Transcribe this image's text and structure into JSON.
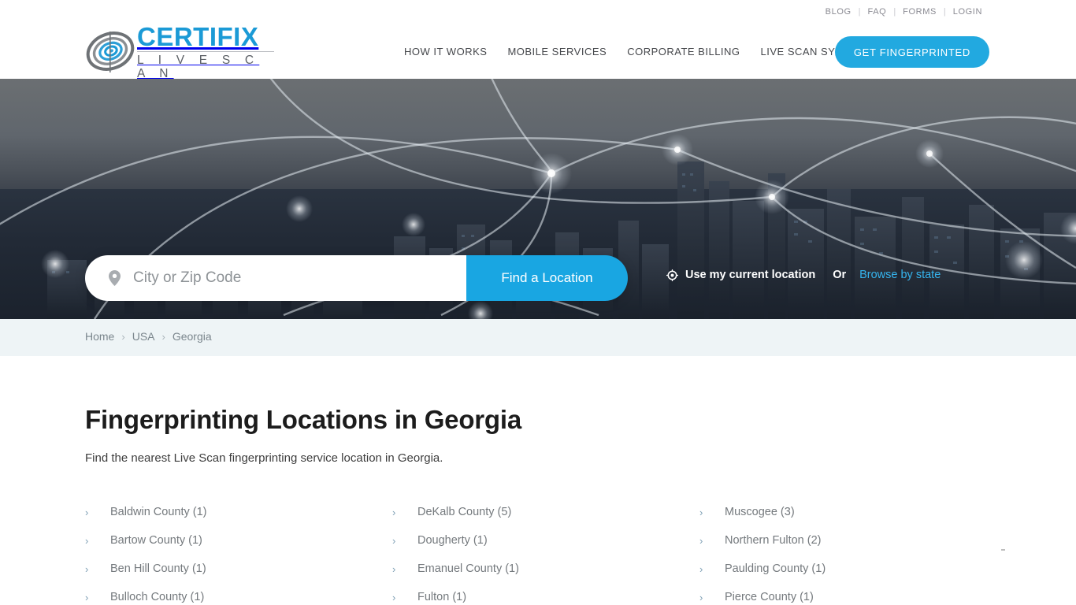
{
  "utility_nav": {
    "items": [
      {
        "label": "BLOG"
      },
      {
        "label": "FAQ"
      },
      {
        "label": "FORMS"
      },
      {
        "label": "LOGIN"
      }
    ],
    "separator": "|"
  },
  "brand": {
    "name_top": "CERTIFIX",
    "name_bottom": "L I V E S C A N",
    "logo_icon": "spiral-fingerprint-icon",
    "color_primary": "#1b9ad6",
    "color_secondary": "#5c6066"
  },
  "main_nav": {
    "items": [
      {
        "label": "HOW IT WORKS"
      },
      {
        "label": "MOBILE SERVICES"
      },
      {
        "label": "CORPORATE BILLING"
      },
      {
        "label": "LIVE SCAN SYSTEM"
      }
    ],
    "cta_label": "GET FINGERPRINTED",
    "cta_color": "#22a9e0"
  },
  "hero": {
    "background_description": "aerial city skyline with network node overlay",
    "search": {
      "pin_icon": "map-pin-icon",
      "placeholder": "City or Zip Code",
      "value": "",
      "button_label": "Find a Location",
      "button_color": "#19a6e2"
    },
    "locate_icon": "crosshair-icon",
    "locate_label": "Use my current location",
    "or_label": "Or",
    "browse_label": "Browse by state",
    "browse_color": "#35b4ee"
  },
  "breadcrumb": {
    "separator": "›",
    "items": [
      {
        "label": "Home"
      },
      {
        "label": "USA"
      },
      {
        "label": "Georgia"
      }
    ]
  },
  "main": {
    "title": "Fingerprinting Locations in Georgia",
    "subtitle": "Find the nearest Live Scan fingerprinting service location in Georgia.",
    "chevron": "›",
    "columns": [
      {
        "items": [
          {
            "label": "Baldwin County (1)"
          },
          {
            "label": "Bartow County (1)"
          },
          {
            "label": "Ben Hill County (1)"
          },
          {
            "label": "Bulloch County (1)"
          }
        ]
      },
      {
        "items": [
          {
            "label": "DeKalb County (5)"
          },
          {
            "label": "Dougherty (1)"
          },
          {
            "label": "Emanuel County (1)"
          },
          {
            "label": "Fulton (1)"
          }
        ]
      },
      {
        "items": [
          {
            "label": "Muscogee (3)"
          },
          {
            "label": "Northern Fulton (2)"
          },
          {
            "label": "Paulding County (1)"
          },
          {
            "label": "Pierce County (1)"
          }
        ]
      }
    ]
  }
}
